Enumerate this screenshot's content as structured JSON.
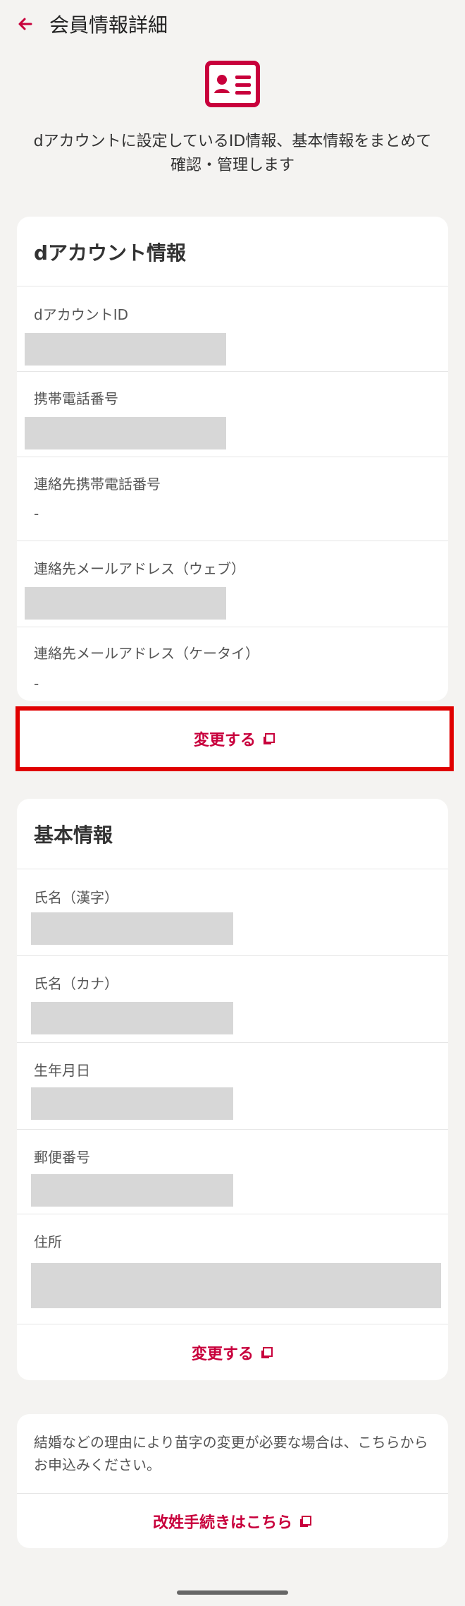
{
  "header": {
    "title": "会員情報詳細"
  },
  "intro": {
    "text": "dアカウントに設定しているID情報、基本情報をまとめて確認・管理します"
  },
  "account_section": {
    "title": "dアカウント情報",
    "fields": [
      {
        "label": "dアカウントID",
        "value": ""
      },
      {
        "label": "携帯電話番号",
        "value": ""
      },
      {
        "label": "連絡先携帯電話番号",
        "value": "-"
      },
      {
        "label": "連絡先メールアドレス（ウェブ）",
        "value": ""
      },
      {
        "label": "連絡先メールアドレス（ケータイ）",
        "value": "-"
      }
    ],
    "action_label": "変更する"
  },
  "basic_section": {
    "title": "基本情報",
    "fields": [
      {
        "label": "氏名（漢字）",
        "value": ""
      },
      {
        "label": "氏名（カナ）",
        "value": ""
      },
      {
        "label": "生年月日",
        "value": ""
      },
      {
        "label": "郵便番号",
        "value": ""
      },
      {
        "label": "住所",
        "value": ""
      }
    ],
    "action_label": "変更する"
  },
  "notice": {
    "text": "結婚などの理由により苗字の変更が必要な場合は、こちらからお申込みください。",
    "action_label": "改姓手続きはこちら"
  },
  "icons": {
    "back": "arrow-left-icon",
    "hero": "id-card-icon",
    "external": "external-window-icon"
  },
  "colors": {
    "accent": "#c8003c",
    "highlight": "#e00000",
    "mask": "#d7d7d7",
    "background": "#f4f3f1"
  }
}
